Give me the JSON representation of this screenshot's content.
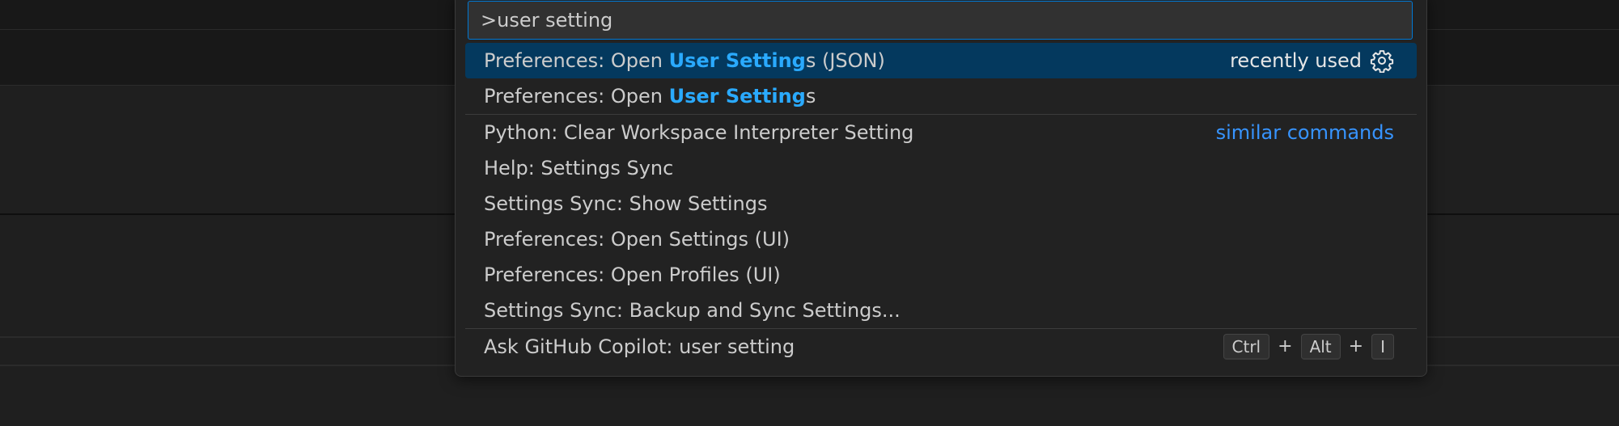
{
  "palette": {
    "input_value": ">user setting",
    "items": [
      {
        "pre": "Preferences: Open ",
        "match": "User Setting",
        "post": "s (JSON)",
        "right_label": "recently used",
        "right_icon": "gear-icon",
        "selected": true
      },
      {
        "pre": "Preferences: Open ",
        "match": "User Setting",
        "post": "s"
      },
      {
        "label": "Python: Clear Workspace Interpreter Setting",
        "right_link": "similar commands"
      },
      {
        "label": "Help: Settings Sync"
      },
      {
        "label": "Settings Sync: Show Settings"
      },
      {
        "label": "Preferences: Open Settings (UI)"
      },
      {
        "label": "Preferences: Open Profiles (UI)"
      },
      {
        "label": "Settings Sync: Backup and Sync Settings..."
      },
      {
        "label": "Ask GitHub Copilot: user setting",
        "keys": [
          "Ctrl",
          "Alt",
          "I"
        ],
        "key_separator": "+"
      }
    ]
  },
  "colors": {
    "selection_bg": "#04395e",
    "highlight": "#2aaaff",
    "link": "#3794ff",
    "focus_border": "#0078d4"
  }
}
